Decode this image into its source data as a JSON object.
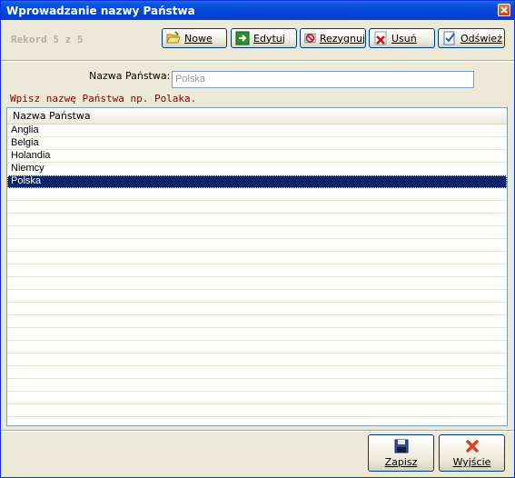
{
  "window": {
    "title": "Wprowadzanie nazwy Państwa"
  },
  "toolbar": {
    "record": "Rekord 5 z 5",
    "buttons": [
      {
        "label": "Nowe",
        "icon": "folder-open-icon"
      },
      {
        "label": "Edytuj",
        "icon": "arrow-right-icon"
      },
      {
        "label": "Rezygnuj",
        "icon": "cancel-icon"
      },
      {
        "label": "Usuń",
        "icon": "delete-x-icon"
      },
      {
        "label": "Odśwież",
        "icon": "refresh-check-icon"
      }
    ]
  },
  "form": {
    "label": "Nazwa Państwa:",
    "value": "Polska",
    "hint": "Wpisz nazwę Państwa np. Polaka."
  },
  "grid": {
    "column": "Nazwa Państwa",
    "rows": [
      "Anglia",
      "Belgia",
      "Holandia",
      "Niemcy",
      "Polska"
    ],
    "selected_index": 4
  },
  "footer": {
    "save": "Zapisz",
    "exit": "Wyjście"
  },
  "colors": {
    "title_bar": "#0a57e0",
    "selection": "#0a246a",
    "hint": "#800000"
  }
}
